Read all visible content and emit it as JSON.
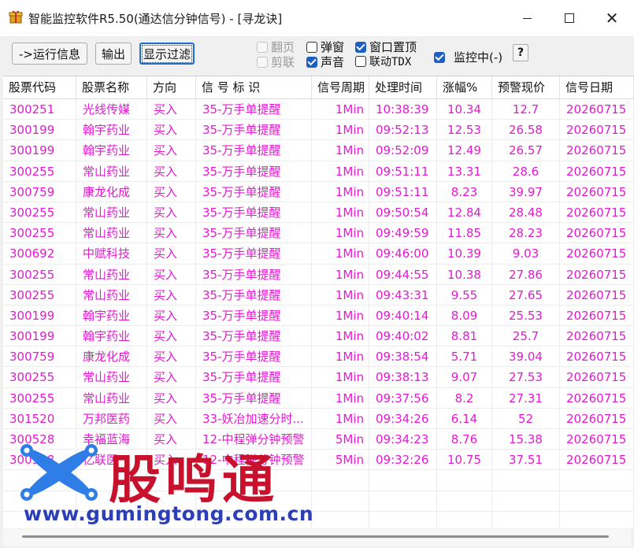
{
  "window": {
    "title": "智能监控软件R5.50(通达信分钟信号) - [寻龙诀]"
  },
  "toolbar": {
    "run_info_label": "->运行信息",
    "output_label": "输出",
    "filter_label": "显示过滤",
    "help_label": "?",
    "checkboxes": {
      "page_flip": {
        "label": "翻页",
        "checked": false,
        "disabled": true
      },
      "clip_link": {
        "label": "剪联",
        "checked": false,
        "disabled": true
      },
      "popup": {
        "label": "弹窗",
        "checked": false
      },
      "sound": {
        "label": "声音",
        "checked": true
      },
      "on_top": {
        "label": "窗口置顶",
        "checked": true
      },
      "link_tdx": {
        "label": "联动TDX",
        "checked": false
      },
      "monitoring": {
        "label": "监控中(-)",
        "checked": true
      }
    }
  },
  "table": {
    "columns": [
      "股票代码",
      "股票名称",
      "方向",
      "信 号 标 识",
      "信号周期",
      "处理时间",
      "涨幅%",
      "预警现价",
      "信号日期"
    ],
    "row_color": "#e31ad1",
    "rows": [
      [
        "300251",
        "光线传媒",
        "买入",
        "35-万手单提醒",
        "1Min",
        "10:38:39",
        "10.34",
        "12.7",
        "20260715"
      ],
      [
        "300199",
        "翰宇药业",
        "买入",
        "35-万手单提醒",
        "1Min",
        "09:52:13",
        "12.53",
        "26.58",
        "20260715"
      ],
      [
        "300199",
        "翰宇药业",
        "买入",
        "35-万手单提醒",
        "1Min",
        "09:52:09",
        "12.49",
        "26.57",
        "20260715"
      ],
      [
        "300255",
        "常山药业",
        "买入",
        "35-万手单提醒",
        "1Min",
        "09:51:11",
        "13.31",
        "28.6",
        "20260715"
      ],
      [
        "300759",
        "康龙化成",
        "买入",
        "35-万手单提醒",
        "1Min",
        "09:51:11",
        "8.23",
        "39.97",
        "20260715"
      ],
      [
        "300255",
        "常山药业",
        "买入",
        "35-万手单提醒",
        "1Min",
        "09:50:54",
        "12.84",
        "28.48",
        "20260715"
      ],
      [
        "300255",
        "常山药业",
        "买入",
        "35-万手单提醒",
        "1Min",
        "09:49:59",
        "11.85",
        "28.23",
        "20260715"
      ],
      [
        "300692",
        "中赋科技",
        "买入",
        "35-万手单提醒",
        "1Min",
        "09:46:00",
        "10.39",
        "9.03",
        "20260715"
      ],
      [
        "300255",
        "常山药业",
        "买入",
        "35-万手单提醒",
        "1Min",
        "09:44:55",
        "10.38",
        "27.86",
        "20260715"
      ],
      [
        "300255",
        "常山药业",
        "买入",
        "35-万手单提醒",
        "1Min",
        "09:43:31",
        "9.55",
        "27.65",
        "20260715"
      ],
      [
        "300199",
        "翰宇药业",
        "买入",
        "35-万手单提醒",
        "1Min",
        "09:40:14",
        "8.09",
        "25.53",
        "20260715"
      ],
      [
        "300199",
        "翰宇药业",
        "买入",
        "35-万手单提醒",
        "1Min",
        "09:40:02",
        "8.81",
        "25.7",
        "20260715"
      ],
      [
        "300759",
        "康龙化成",
        "买入",
        "35-万手单提醒",
        "1Min",
        "09:38:54",
        "5.71",
        "39.04",
        "20260715"
      ],
      [
        "300255",
        "常山药业",
        "买入",
        "35-万手单提醒",
        "1Min",
        "09:38:13",
        "9.07",
        "27.53",
        "20260715"
      ],
      [
        "300255",
        "常山药业",
        "买入",
        "35-万手单提醒",
        "1Min",
        "09:37:56",
        "8.2",
        "27.31",
        "20260715"
      ],
      [
        "301520",
        "万邦医药",
        "买入",
        "33-妖冶加速分时...",
        "1Min",
        "09:34:26",
        "6.14",
        "52",
        "20260715"
      ],
      [
        "300528",
        "幸福蓝海",
        "买入",
        "12-中程弹分钟预警",
        "5Min",
        "09:34:23",
        "8.76",
        "15.38",
        "20260715"
      ],
      [
        "300528",
        "亿联医",
        "买入",
        "12-中程弹分钟预警",
        "5Min",
        "09:32:26",
        "10.75",
        "37.51",
        "20260715"
      ]
    ]
  },
  "watermark": {
    "name": "股鸣通",
    "url": "www.gumingtong.com.cn",
    "name_color": "#c8112d",
    "url_color": "#2c3fb6",
    "logo_color": "#2f7de6"
  }
}
